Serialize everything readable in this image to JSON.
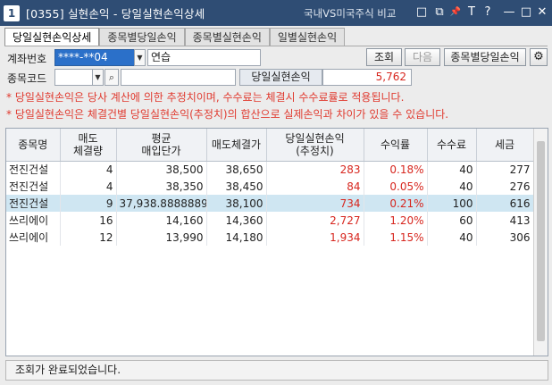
{
  "window": {
    "number": "1",
    "title": "[0355] 실현손익 - 당일실현손익상세",
    "subtitle": "국내VS미국주식 비교",
    "controls": [
      "□",
      "⧉",
      "📌",
      "T",
      "?",
      "—",
      "□",
      "✕"
    ]
  },
  "tabs": [
    {
      "label": "당일실현손익상세",
      "active": true
    },
    {
      "label": "종목별당일손익",
      "active": false
    },
    {
      "label": "종목별실현손익",
      "active": false
    },
    {
      "label": "일별실현손익",
      "active": false
    }
  ],
  "form": {
    "account_label": "계좌번호",
    "account_value": "****-**04",
    "account_name": "연습",
    "stock_code_label": "종목코드",
    "stock_code_value": "",
    "stock_name_value": "",
    "realized_label": "당일실현손익",
    "realized_value": "5,762",
    "query_button": "조회",
    "next_button": "다음",
    "by_stock_button": "종목별당일손익"
  },
  "notes": [
    "* 당일실현손익은 당사 계산에 의한 추정치이며, 수수료는 체결시 수수료률로 적용됩니다.",
    "* 당일실현손익은 체결건별 당일실현손익(추정치)의 합산으로 실제손익과 차이가 있을 수 있습니다."
  ],
  "table": {
    "headers": [
      "종목명",
      "매도\n체결량",
      "평균\n매입단가",
      "매도체결가",
      "당일실현손익\n(추정치)",
      "수익률",
      "수수료",
      "세금"
    ],
    "rows": [
      {
        "name": "전진건설",
        "qty": "4",
        "avg_price": "38,500",
        "sell_price": "38,650",
        "pnl": "283",
        "rate": "0.18%",
        "fee": "40",
        "tax": "277",
        "selected": false
      },
      {
        "name": "전진건설",
        "qty": "4",
        "avg_price": "38,350",
        "sell_price": "38,450",
        "pnl": "84",
        "rate": "0.05%",
        "fee": "40",
        "tax": "276",
        "selected": false
      },
      {
        "name": "전진건설",
        "qty": "9",
        "avg_price": "37,938.8888889",
        "sell_price": "38,100",
        "pnl": "734",
        "rate": "0.21%",
        "fee": "100",
        "tax": "616",
        "selected": true
      },
      {
        "name": "쓰리에이",
        "qty": "16",
        "avg_price": "14,160",
        "sell_price": "14,360",
        "pnl": "2,727",
        "rate": "1.20%",
        "fee": "60",
        "tax": "413",
        "selected": false
      },
      {
        "name": "쓰리에이",
        "qty": "12",
        "avg_price": "13,990",
        "sell_price": "14,180",
        "pnl": "1,934",
        "rate": "1.15%",
        "fee": "40",
        "tax": "306",
        "selected": false
      }
    ]
  },
  "status": "조회가 완료되었습니다.",
  "colors": {
    "titlebar": "#2f4d74",
    "profit": "#d7261e",
    "selected_row": "#cfe6f2",
    "note": "#e03a2f"
  }
}
